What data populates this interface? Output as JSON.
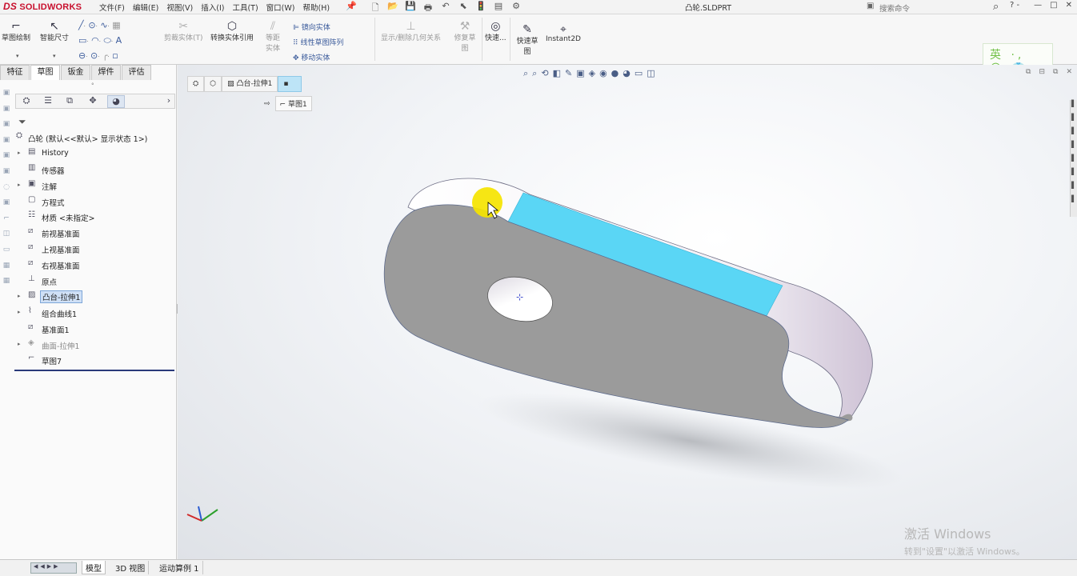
{
  "titlebar": {
    "brand": "SOLIDWORKS",
    "brand_prefix": "DS",
    "menus": [
      "文件(F)",
      "编辑(E)",
      "视图(V)",
      "插入(I)",
      "工具(T)",
      "窗口(W)",
      "帮助(H)"
    ],
    "document_title": "凸轮.SLDPRT",
    "search_placeholder": "搜索命令",
    "help": "? -",
    "window_buttons": [
      "—",
      "□",
      "✕"
    ]
  },
  "commandbar": {
    "sketch_label": "草图绘制",
    "smart_dim_label": "智能尺寸",
    "trim_label": "剪裁实体(T)",
    "convert_label": "转换实体引用",
    "offset_label": "等距实体",
    "mirror_label": "镜向实体",
    "linear_pattern_label": "线性草图阵列",
    "move_label": "移动实体",
    "display_relations_label": "显示/删除几何关系",
    "repair_label": "修复草图",
    "quick_snap_label": "快速...",
    "quick_sketch_label": "快速草图",
    "instant2d_label": "Instant2D",
    "ime_label": "英 ·, ☺ 👕"
  },
  "feature_manager": {
    "tabs": [
      "特征",
      "草图",
      "钣金",
      "焊件",
      "评估"
    ],
    "active_tab": "草图",
    "tree": [
      {
        "label": "凸轮 (默认<<默认> 显示状态 1>)",
        "icon": "part-icon",
        "expandable": false,
        "root": true
      },
      {
        "label": "History",
        "icon": "history-icon",
        "expandable": true
      },
      {
        "label": "传感器",
        "icon": "sensors-icon",
        "expandable": false
      },
      {
        "label": "注解",
        "icon": "annotations-icon",
        "expandable": true
      },
      {
        "label": "方程式",
        "icon": "equations-icon",
        "expandable": false
      },
      {
        "label": "材质 <未指定>",
        "icon": "material-icon",
        "expandable": false
      },
      {
        "label": "前视基准面",
        "icon": "plane-icon",
        "expandable": false
      },
      {
        "label": "上视基准面",
        "icon": "plane-icon",
        "expandable": false
      },
      {
        "label": "右视基准面",
        "icon": "plane-icon",
        "expandable": false
      },
      {
        "label": "原点",
        "icon": "origin-icon",
        "expandable": false
      },
      {
        "label": "凸台-拉伸1",
        "icon": "extrude-icon",
        "expandable": true,
        "selected": true
      },
      {
        "label": "组合曲线1",
        "icon": "curve-icon",
        "expandable": true
      },
      {
        "label": "基准面1",
        "icon": "plane-icon",
        "expandable": false
      },
      {
        "label": "曲面-拉伸1",
        "icon": "surface-icon",
        "expandable": true,
        "faded": true
      },
      {
        "label": "草图7",
        "icon": "sketch-icon",
        "expandable": false
      }
    ]
  },
  "viewport": {
    "breadcrumb": [
      "凸台-拉伸1"
    ],
    "sub_breadcrumb": "草图1",
    "watermark_line1": "激活 Windows",
    "watermark_line2": "转到\"设置\"以激活 Windows。",
    "colors": {
      "body": "#9b9b9b",
      "selected_face": "#5ad6f5",
      "highlight": "#f5e400",
      "edge": "#5c6a8c"
    }
  },
  "statusbar": {
    "tabs": [
      "模型",
      "3D 视图",
      "运动算例 1"
    ],
    "active_tab": "模型"
  }
}
